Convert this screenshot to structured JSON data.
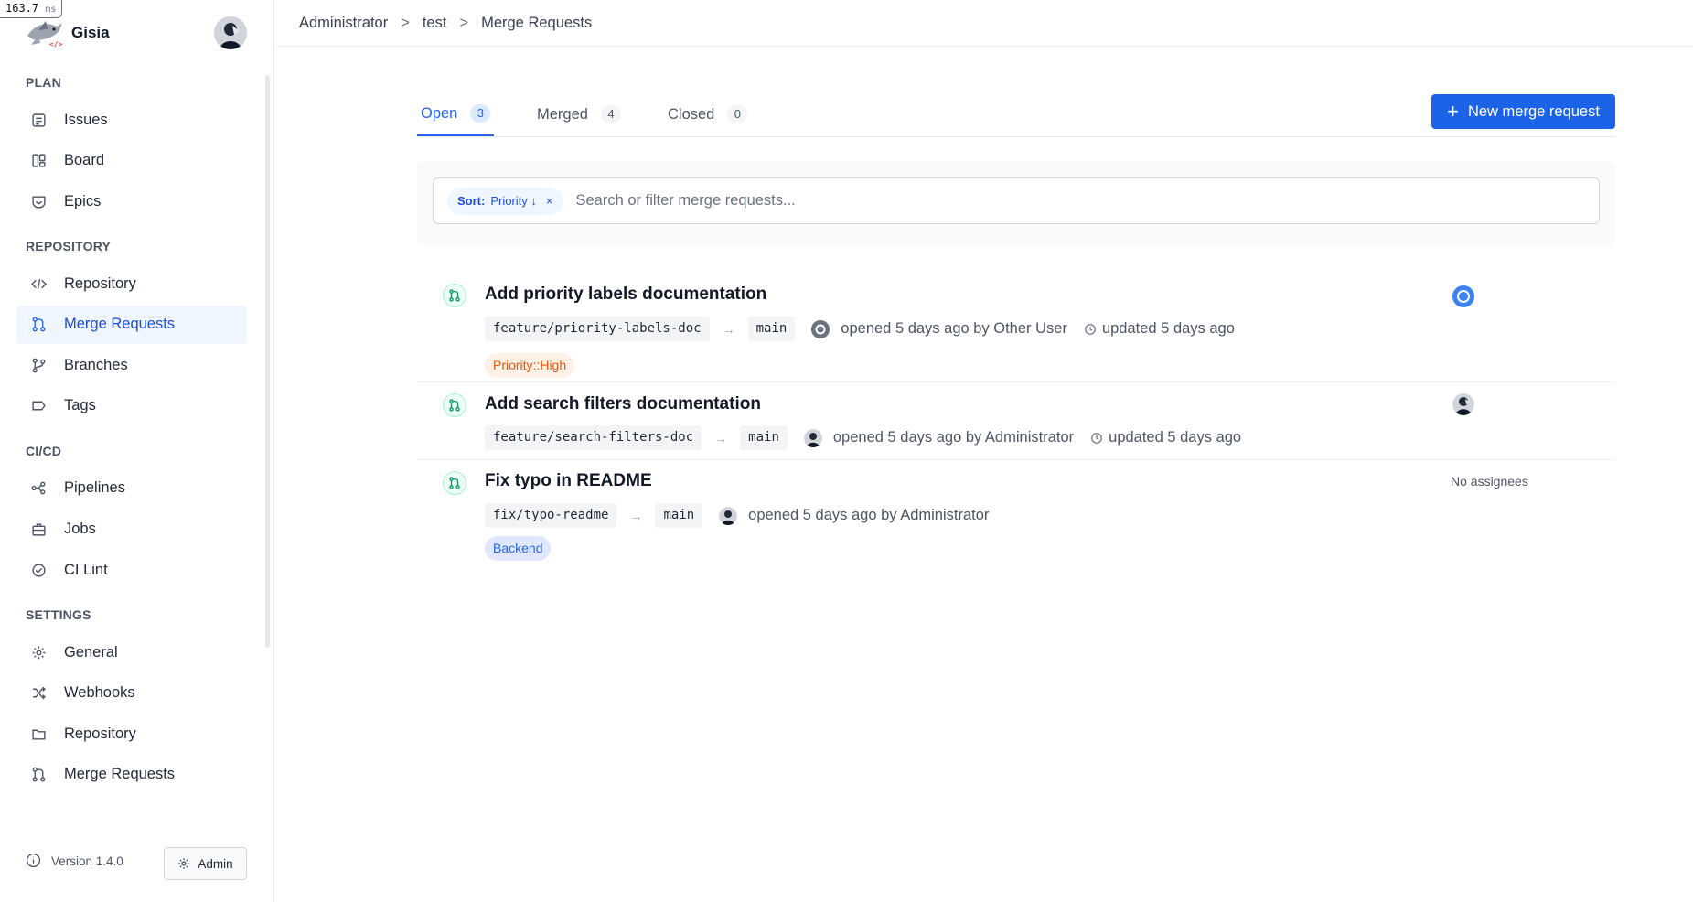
{
  "timing": {
    "value": "163.7",
    "unit": "ms"
  },
  "app": {
    "name": "Gisia"
  },
  "sidebar": {
    "sections": [
      {
        "title": "PLAN",
        "items": [
          {
            "label": "Issues",
            "icon": "issues-icon"
          },
          {
            "label": "Board",
            "icon": "board-icon"
          },
          {
            "label": "Epics",
            "icon": "epics-icon"
          }
        ]
      },
      {
        "title": "REPOSITORY",
        "items": [
          {
            "label": "Repository",
            "icon": "code-icon"
          },
          {
            "label": "Merge Requests",
            "icon": "merge-request-icon",
            "active": true
          },
          {
            "label": "Branches",
            "icon": "branch-icon"
          },
          {
            "label": "Tags",
            "icon": "tag-icon"
          }
        ]
      },
      {
        "title": "CI/CD",
        "items": [
          {
            "label": "Pipelines",
            "icon": "pipeline-icon"
          },
          {
            "label": "Jobs",
            "icon": "jobs-icon"
          },
          {
            "label": "CI Lint",
            "icon": "check-circle-icon"
          }
        ]
      },
      {
        "title": "SETTINGS",
        "items": [
          {
            "label": "General",
            "icon": "gear-icon"
          },
          {
            "label": "Webhooks",
            "icon": "webhook-icon"
          },
          {
            "label": "Repository",
            "icon": "folder-icon"
          },
          {
            "label": "Merge Requests",
            "icon": "merge-request-icon"
          }
        ]
      }
    ],
    "footer": {
      "version": "Version 1.4.0",
      "admin_label": "Admin"
    }
  },
  "breadcrumb": [
    "Administrator",
    "test",
    "Merge Requests"
  ],
  "breadcrumb_separator": ">",
  "tabs": [
    {
      "label": "Open",
      "count": "3",
      "active": true
    },
    {
      "label": "Merged",
      "count": "4"
    },
    {
      "label": "Closed",
      "count": "0"
    }
  ],
  "new_button_label": "New merge request",
  "filter": {
    "sort_key": "Sort:",
    "sort_value": "Priority ↓",
    "sort_clear": "×",
    "placeholder": "Search or filter merge requests..."
  },
  "merge_requests": [
    {
      "title": "Add priority labels documentation",
      "source_branch": "feature/priority-labels-doc",
      "target_branch": "main",
      "opened": "opened 5 days ago by Other User",
      "updated": "updated 5 days ago",
      "label": "Priority::High",
      "assignee": "O"
    },
    {
      "title": "Add search filters documentation",
      "source_branch": "feature/search-filters-doc",
      "target_branch": "main",
      "opened": "opened 5 days ago by Administrator",
      "updated": "updated 5 days ago"
    },
    {
      "title": "Fix typo in README",
      "source_branch": "fix/typo-readme",
      "target_branch": "main",
      "opened": "opened 5 days ago by Administrator",
      "label": "Backend",
      "no_assignees": "No assignees"
    }
  ],
  "colors": {
    "accent": "#1d63e8",
    "active_nav_bg": "#eff6ff",
    "priority_high": "#ea580c",
    "backend_label": "#2563eb"
  }
}
